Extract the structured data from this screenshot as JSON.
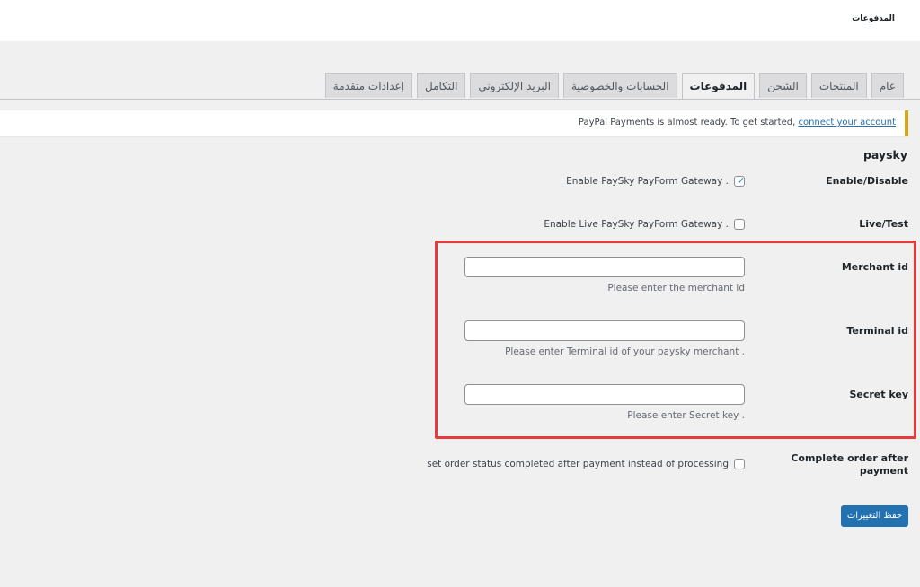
{
  "header": {
    "title": "المدفوعات"
  },
  "tabs": [
    {
      "label": "عام",
      "active": false
    },
    {
      "label": "المنتجات",
      "active": false
    },
    {
      "label": "الشحن",
      "active": false
    },
    {
      "label": "المدفوعات",
      "active": true
    },
    {
      "label": "الحسابات والخصوصية",
      "active": false
    },
    {
      "label": "البريد الإلكتروني",
      "active": false
    },
    {
      "label": "التكامل",
      "active": false
    },
    {
      "label": "إعدادات متقدمة",
      "active": false
    }
  ],
  "notice": {
    "text": "PayPal Payments is almost ready. To get started,",
    "link": "connect your account"
  },
  "section": {
    "title": "paysky"
  },
  "settings": {
    "enable": {
      "label": "Enable/Disable",
      "text": "Enable PaySky PayForm Gateway .",
      "checked": true
    },
    "live": {
      "label": "Live/Test",
      "text": "Enable Live PaySky PayForm Gateway .",
      "checked": false
    },
    "merchant": {
      "label": "Merchant id",
      "value": "",
      "desc": "Please enter the merchant id"
    },
    "terminal": {
      "label": "Terminal id",
      "value": "",
      "desc": "Please enter Terminal id of your paysky merchant ."
    },
    "secret": {
      "label": "Secret key",
      "value": "",
      "desc": "Please enter Secret key ."
    },
    "complete": {
      "label_line1": "Complete order after",
      "label_line2": "payment",
      "text": "set order status completed after payment instead of processing",
      "checked": false
    }
  },
  "actions": {
    "save_label": "حفظ التغييرات"
  },
  "colors": {
    "accent": "#2271b1",
    "highlight": "#e53b3b",
    "notice_border": "#dba617",
    "background": "#f0f0f1"
  }
}
